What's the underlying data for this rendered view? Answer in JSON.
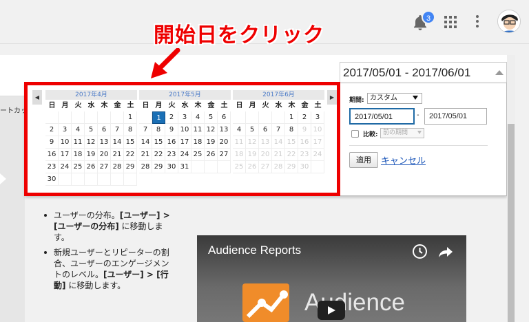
{
  "topbar": {
    "notification_count": "3",
    "bell_icon": "bell-icon",
    "apps_icon": "apps-grid-icon",
    "more_icon": "more-vert-icon",
    "avatar_icon": "user-avatar"
  },
  "annotation": {
    "text": "開始日をクリック",
    "color": "#e00000"
  },
  "left_panel": {
    "shortcut_label": "ートカット"
  },
  "date_range": {
    "label": "2017/05/01 - 2017/06/01"
  },
  "calendar": {
    "prev_label": "◀",
    "next_label": "▶",
    "weekdays": [
      "日",
      "月",
      "火",
      "水",
      "木",
      "金",
      "土"
    ],
    "months": [
      {
        "title": "2017年4月",
        "days": [
          "",
          "",
          "",
          "",
          "",
          "",
          "1",
          "2",
          "3",
          "4",
          "5",
          "6",
          "7",
          "8",
          "9",
          "10",
          "11",
          "12",
          "13",
          "14",
          "15",
          "16",
          "17",
          "18",
          "19",
          "20",
          "21",
          "22",
          "23",
          "24",
          "25",
          "26",
          "27",
          "28",
          "29",
          "30"
        ]
      },
      {
        "title": "2017年5月",
        "days": [
          "",
          "1",
          "2",
          "3",
          "4",
          "5",
          "6",
          "7",
          "8",
          "9",
          "10",
          "11",
          "12",
          "13",
          "14",
          "15",
          "16",
          "17",
          "18",
          "19",
          "20",
          "21",
          "22",
          "23",
          "24",
          "25",
          "26",
          "27",
          "28",
          "29",
          "30",
          "31"
        ],
        "selected": "1"
      },
      {
        "title": "2017年6月",
        "days": [
          "",
          "",
          "",
          "",
          "1",
          "2",
          "3",
          "4",
          "5",
          "6",
          "7",
          "8",
          "9",
          "10",
          "11",
          "12",
          "13",
          "14",
          "15",
          "16",
          "17",
          "18",
          "19",
          "20",
          "21",
          "22",
          "23",
          "24",
          "25",
          "26",
          "27",
          "28",
          "29",
          "30"
        ],
        "enabled_until": "8"
      }
    ]
  },
  "controls": {
    "period_label": "期間:",
    "period_value": "カスタム",
    "start_date": "2017/05/01",
    "dash": "-",
    "end_date": "2017/05/01",
    "compare_label": "比較:",
    "compare_value": "前の期間",
    "apply_label": "適用",
    "cancel_label": "キャンセル"
  },
  "bullets": {
    "item1_a": "ユーザーの分布。",
    "item1_b": "[ユーザー] > [ユーザーの分布]",
    "item1_c": " に移動します。",
    "item2_a": "新規ユーザーとリピーターの割合、ユーザーのエンゲージメントのレベル。",
    "item2_b": "[ユーザー] > [行動]",
    "item2_c": " に移動します。"
  },
  "video": {
    "title": "Audience Reports",
    "logo_text": "Audience"
  }
}
